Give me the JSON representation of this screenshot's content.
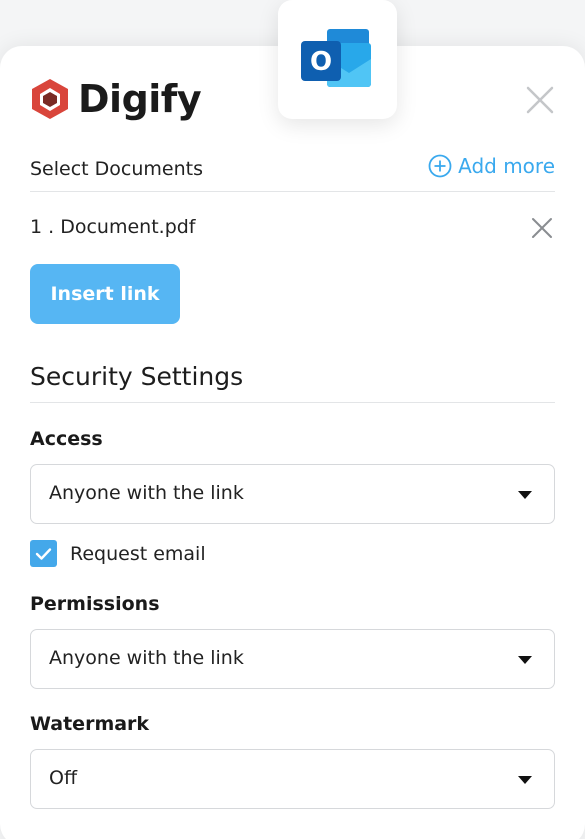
{
  "brand": {
    "name": "Digify",
    "accent": "#d9453b"
  },
  "app_icon": {
    "name": "outlook-icon",
    "letter": "O"
  },
  "documents": {
    "label": "Select Documents",
    "add_more": "Add more",
    "items": [
      {
        "index": "1 .",
        "name": "Document.pdf"
      }
    ]
  },
  "insert_link": "Insert link",
  "security": {
    "title": "Security Settings",
    "access": {
      "label": "Access",
      "value": "Anyone with the link"
    },
    "request_email": {
      "label": "Request email",
      "checked": true
    },
    "permissions": {
      "label": "Permissions",
      "value": "Anyone with the link"
    },
    "watermark": {
      "label": "Watermark",
      "value": "Off"
    }
  },
  "colors": {
    "primary": "#56b6f3",
    "link": "#3aa9ee",
    "checkbox": "#44a8ea"
  }
}
